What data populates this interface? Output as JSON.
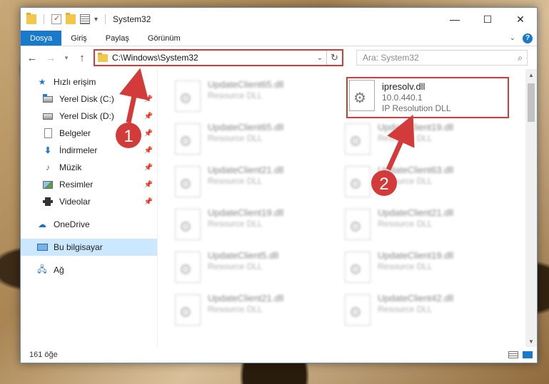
{
  "window": {
    "title": "System32",
    "controls": {
      "minimize": "—",
      "maximize": "☐",
      "close": "✕"
    }
  },
  "ribbon": {
    "tabs": [
      "Dosya",
      "Giriş",
      "Paylaş",
      "Görünüm"
    ],
    "help": "?"
  },
  "address": {
    "path": "C:\\Windows\\System32",
    "search_placeholder": "Ara: System32"
  },
  "sidebar": {
    "quick_access": "Hızlı erişim",
    "items": [
      {
        "label": "Yerel Disk (C:)",
        "icon": "drive-c-icon"
      },
      {
        "label": "Yerel Disk (D:)",
        "icon": "drive-d-icon"
      },
      {
        "label": "Belgeler",
        "icon": "documents-icon"
      },
      {
        "label": "İndirmeler",
        "icon": "downloads-icon"
      },
      {
        "label": "Müzik",
        "icon": "music-icon"
      },
      {
        "label": "Resimler",
        "icon": "pictures-icon"
      },
      {
        "label": "Videolar",
        "icon": "videos-icon"
      }
    ],
    "onedrive": "OneDrive",
    "this_pc": "Bu bilgisayar",
    "network": "Ağ"
  },
  "files": {
    "highlighted": {
      "name": "ipresolv.dll",
      "version": "10.0.440.1",
      "description": "IP Resolution DLL"
    },
    "left_column": [
      {
        "name": "UpdateClient65.dll",
        "type": "Resource DLL"
      },
      {
        "name": "UpdateClient65.dll",
        "type": "Resource DLL"
      },
      {
        "name": "UpdateClient21.dll",
        "type": "Resource DLL"
      },
      {
        "name": "UpdateClient19.dll",
        "type": "Resource DLL"
      },
      {
        "name": "UpdateClient5.dll",
        "type": "Resource DLL"
      },
      {
        "name": "UpdateClient21.dll",
        "type": "Resource DLL"
      }
    ],
    "right_column": [
      {
        "name": "UpdateClient19.dll",
        "type": "Resource DLL"
      },
      {
        "name": "UpdateClient63.dll",
        "type": "Resource DLL"
      },
      {
        "name": "UpdateClient21.dll",
        "type": "Resource DLL"
      },
      {
        "name": "UpdateClient19.dll",
        "type": "Resource DLL"
      },
      {
        "name": "UpdateClient42.dll",
        "type": "Resource DLL"
      }
    ]
  },
  "status": {
    "count": "161 öğe"
  },
  "annotations": {
    "step1": "1",
    "step2": "2",
    "color": "#d33a3a"
  }
}
